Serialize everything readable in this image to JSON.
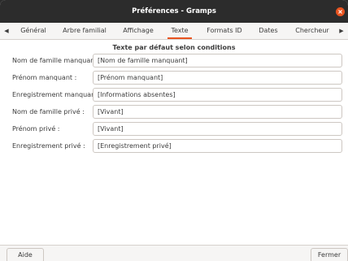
{
  "window": {
    "title": "Préférences - Gramps"
  },
  "tabs": [
    {
      "label": "Général"
    },
    {
      "label": "Arbre familial"
    },
    {
      "label": "Affichage"
    },
    {
      "label": "Texte"
    },
    {
      "label": "Formats ID"
    },
    {
      "label": "Dates"
    },
    {
      "label": "Chercheur"
    }
  ],
  "tab_arrows": {
    "left": "◀",
    "right": "▶"
  },
  "section": {
    "heading": "Texte par défaut selon conditions",
    "rows": [
      {
        "label": "Nom de famille manquant :",
        "value": "[Nom de famille manquant]"
      },
      {
        "label": "Prénom manquant :",
        "value": "[Prénom manquant]"
      },
      {
        "label": "Enregistrement manquant :",
        "value": "[Informations absentes]"
      },
      {
        "label": "Nom de famille privé :",
        "value": "[Vivant]"
      },
      {
        "label": "Prénom privé :",
        "value": "[Vivant]"
      },
      {
        "label": "Enregistrement privé :",
        "value": "[Enregistrement privé]"
      }
    ]
  },
  "footer": {
    "help_label": "Aide",
    "close_label": "Fermer"
  },
  "colors": {
    "accent": "#e95420",
    "titlebar": "#2c2c2c"
  }
}
